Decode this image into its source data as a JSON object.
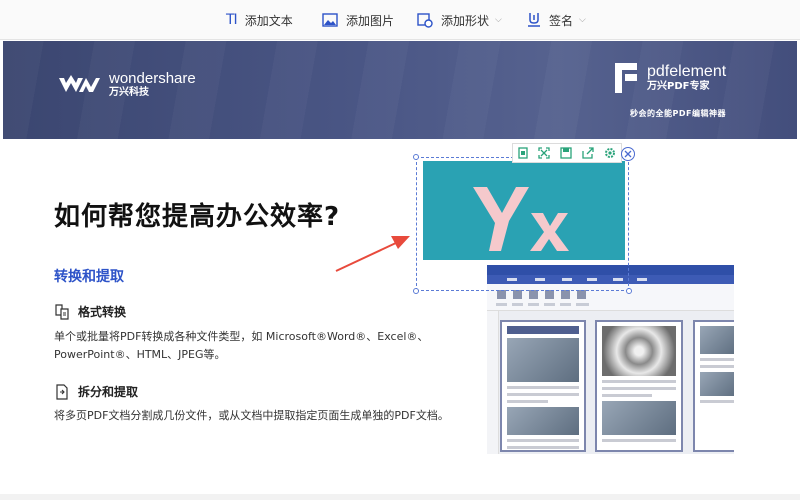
{
  "toolbar": {
    "add_text": "添加文本",
    "add_text_icon": "TI",
    "add_image": "添加图片",
    "add_shape": "添加形状",
    "sign": "签名"
  },
  "banner": {
    "ws_name": "wondershare",
    "ws_cn": "万兴科技",
    "pe_name": "pdfelement",
    "pe_cn": "万兴PDF专家",
    "slogan": "秒会的全能PDF编辑神器"
  },
  "content": {
    "headline": "如何帮您提高办公效率?",
    "section_title": "转换和提取",
    "features": [
      {
        "title": "格式转换",
        "desc": "单个或批量将PDF转换成各种文件类型，如 Microsoft®Word®、Excel®、PowerPoint®、HTML、JPEG等。"
      },
      {
        "title": "拆分和提取",
        "desc": "将多页PDF文档分割成几份文件，或从文档中提取指定页面生成单独的PDF文档。"
      }
    ]
  },
  "colors": {
    "accent": "#2d53c8",
    "banner": "#434e7c",
    "image_bg": "#2aa2b3",
    "image_letters": "#f5c9cc"
  },
  "icons": {
    "image_toolbar": [
      "crop-icon",
      "expand-icon",
      "save-icon",
      "export-icon",
      "settings-icon"
    ],
    "close": "close-icon"
  }
}
